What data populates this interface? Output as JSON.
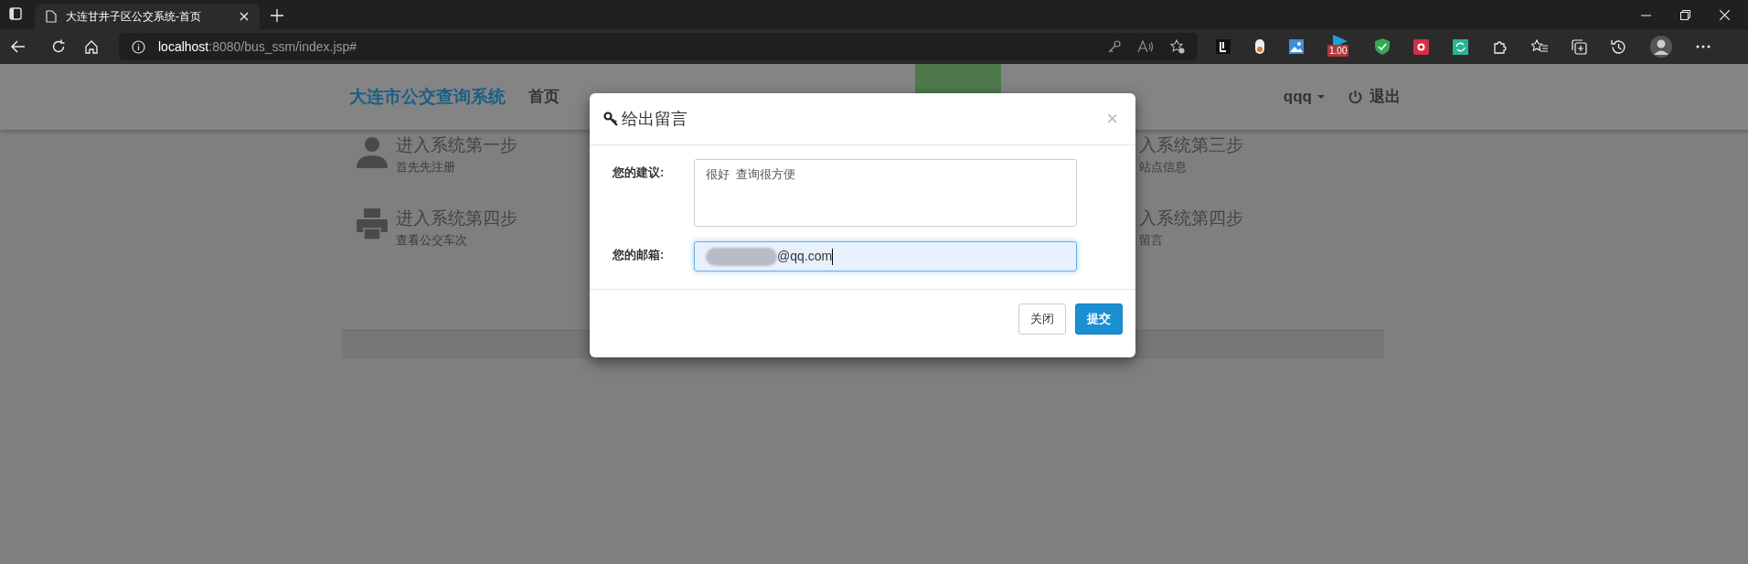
{
  "browser": {
    "tab_title": "大连甘井子区公交系统-首页",
    "url_host": "localhost",
    "url_rest": ":8080/bus_ssm/index.jsp#",
    "extension_badge": "1.00"
  },
  "navbar": {
    "brand": "大连市公交查询系统",
    "items": [
      {
        "label": "首页",
        "selected": false
      },
      {
        "selected": true
      }
    ],
    "user": "qqq",
    "logout": "退出"
  },
  "left_steps": [
    {
      "kind": "user",
      "title": "进入系统第一步",
      "subtitle": "首先先注册"
    },
    {
      "kind": "printer",
      "title": "进入系统第四步",
      "subtitle": "查看公交车次"
    }
  ],
  "right_steps": [
    {
      "title": "入系统第三步",
      "subtitle": "站点信息"
    },
    {
      "title": "入系统第四步",
      "subtitle": "留言"
    }
  ],
  "modal": {
    "title": "给出留言",
    "close": "×",
    "fields": [
      {
        "kind": "textarea",
        "label": "您的建议:",
        "value": "很好  查询很方便",
        "focused": false
      },
      {
        "kind": "input",
        "label": "您的邮箱:",
        "value": "@qq.com",
        "focused": true
      }
    ],
    "buttons": [
      {
        "label": "关闭",
        "kind": "default"
      },
      {
        "label": "提交",
        "kind": "primary"
      }
    ]
  }
}
